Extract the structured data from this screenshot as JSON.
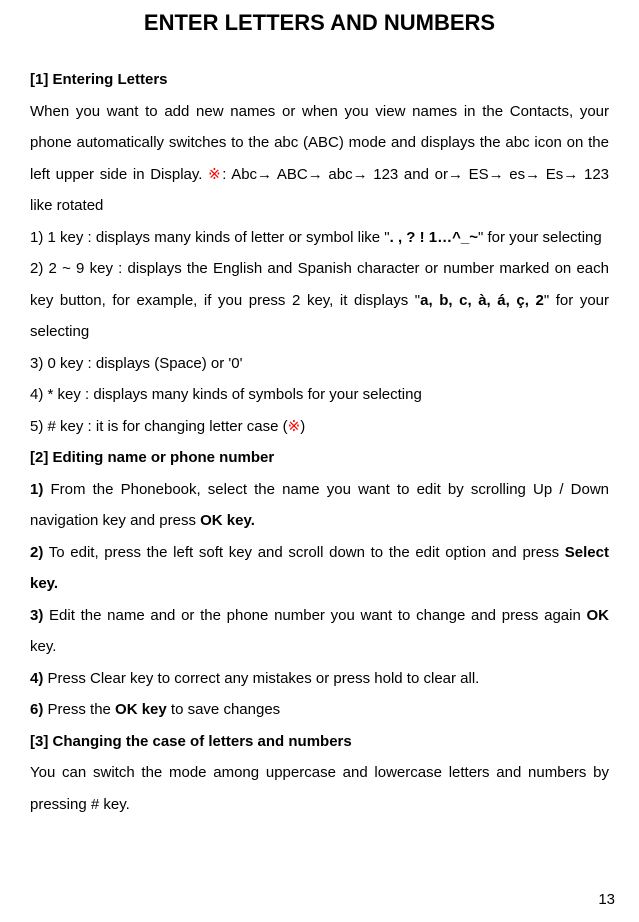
{
  "title": "ENTER LETTERS AND NUMBERS",
  "section1": {
    "heading": "[1]  Entering Letters",
    "p1_a": "When you want to add new names or when you view names in the Contacts, your phone automatically switches to the abc (ABC) mode and displays the abc icon on the left upper side in Display. ",
    "star1": "※",
    "p1_b": ": Abc→ ABC→ abc→ 123 and or→ ES→ es→ Es→ 123 like rotated",
    "item1_a": "1) 1 key : displays many kinds of letter or symbol like \"",
    "item1_bold": ". , ? ! 1…^_~",
    "item1_b": "\" for your selecting",
    "item2_a": "2) 2 ~ 9 key : displays the English and Spanish character or number marked on each key button, for example, if you press 2 key, it displays \"",
    "item2_bold": "a, b, c, à, á, ç, 2",
    "item2_b": "\" for your selecting",
    "item3": "3) 0 key : displays (Space) or '0'",
    "item4": "4) * key : displays many kinds of symbols for your selecting",
    "item5_a": "5) # key : it is for changing letter case (",
    "star2": "※",
    "item5_b": ")"
  },
  "section2": {
    "heading": "[2] Editing name or phone number",
    "item1_bold": "1)",
    "item1_a": " From the Phonebook, select the name you want to edit by scrolling Up / Down navigation key and press ",
    "item1_ok": "OK key.",
    "item2_bold": "2)",
    "item2_a": " To edit, press the left soft key and scroll down to the edit option and press ",
    "item2_select": "Select key.",
    "item3_bold": "3)",
    "item3_a": " Edit the name and or the phone number you want to change and press again ",
    "item3_ok": "OK",
    "item3_b": " key.",
    "item4_bold": "4)",
    "item4_a": " Press Clear key to correct any mistakes or press hold to clear all.",
    "item6_bold": "6)",
    "item6_a": " Press the ",
    "item6_ok": "OK key",
    "item6_b": " to save changes"
  },
  "section3": {
    "heading": "[3] Changing the case of letters and numbers",
    "p1": "You can switch the mode among uppercase and lowercase letters and numbers by pressing # key."
  },
  "pageNumber": "13"
}
